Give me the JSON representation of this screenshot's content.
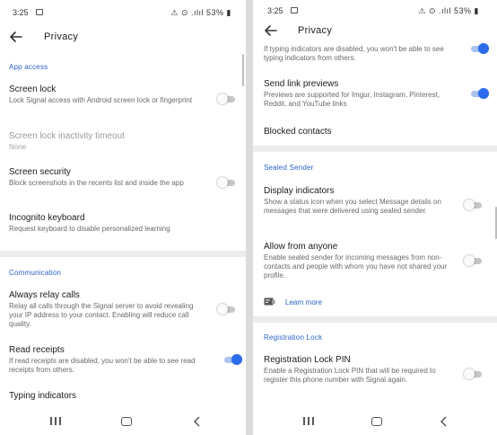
{
  "colors": {
    "accent": "#2c6bed",
    "section": "#2a62c9"
  },
  "left": {
    "status": {
      "time": "3:25",
      "system": "⚠ ⊙ .ılıl 53% ▮"
    },
    "header": {
      "title": "Privacy",
      "back_icon": "arrow-left-icon"
    },
    "sections": {
      "app_access": "App access",
      "communication": "Communication"
    },
    "items": {
      "screen_lock": {
        "title": "Screen lock",
        "desc": "Lock Signal access with Android screen lock or fingerprint",
        "enabled": false
      },
      "inactivity": {
        "title": "Screen lock inactivity timeout",
        "value": "None"
      },
      "screen_security": {
        "title": "Screen security",
        "desc": "Block screenshots in the recents list and inside the app",
        "enabled": false
      },
      "incognito": {
        "title": "Incognito keyboard",
        "desc": "Request keyboard to disable personalized learning"
      },
      "relay_calls": {
        "title": "Always relay calls",
        "desc": "Relay all calls through the Signal server to avoid revealing your IP address to your contact. Enabling will reduce call quality.",
        "enabled": false
      },
      "read_receipts": {
        "title": "Read receipts",
        "desc": "If read receipts are disabled, you won't be able to see read receipts from others.",
        "enabled": true
      },
      "typing": {
        "title": "Typing indicators"
      }
    }
  },
  "right": {
    "status": {
      "time": "3:25",
      "system": "⚠ ⊙ .ılıl 53% ▮"
    },
    "header": {
      "title": "Privacy",
      "back_icon": "arrow-left-icon"
    },
    "sections": {
      "sealed_sender": "Sealed Sender",
      "registration_lock": "Registration Lock"
    },
    "items": {
      "typing_tail": {
        "desc": "If typing indicators are disabled, you won't be able to see typing indicators from others.",
        "enabled": true
      },
      "link_previews": {
        "title": "Send link previews",
        "desc": "Previews are supported for Imgur, Instagram, Pinterest, Reddit, and YouTube links",
        "enabled": true
      },
      "blocked": {
        "title": "Blocked contacts"
      },
      "display_indicators": {
        "title": "Display indicators",
        "desc": "Show a status icon when you select Message details on messages that were delivered using sealed sender.",
        "enabled": false
      },
      "allow_anyone": {
        "title": "Allow from anyone",
        "desc": "Enable sealed sender for incoming messages from non-contacts and people with whom you have not shared your profile.",
        "enabled": false
      },
      "learn_more": {
        "label": "Learn more",
        "icon": "sealed-sender-icon"
      },
      "reg_lock_pin": {
        "title": "Registration Lock PIN",
        "desc": "Enable a Registration Lock PIN that will be required to register this phone number with Signal again.",
        "enabled": false
      }
    }
  },
  "navbar": {
    "recent_icon": "recent-apps-icon",
    "home_icon": "home-icon",
    "back_icon": "nav-back-icon"
  }
}
